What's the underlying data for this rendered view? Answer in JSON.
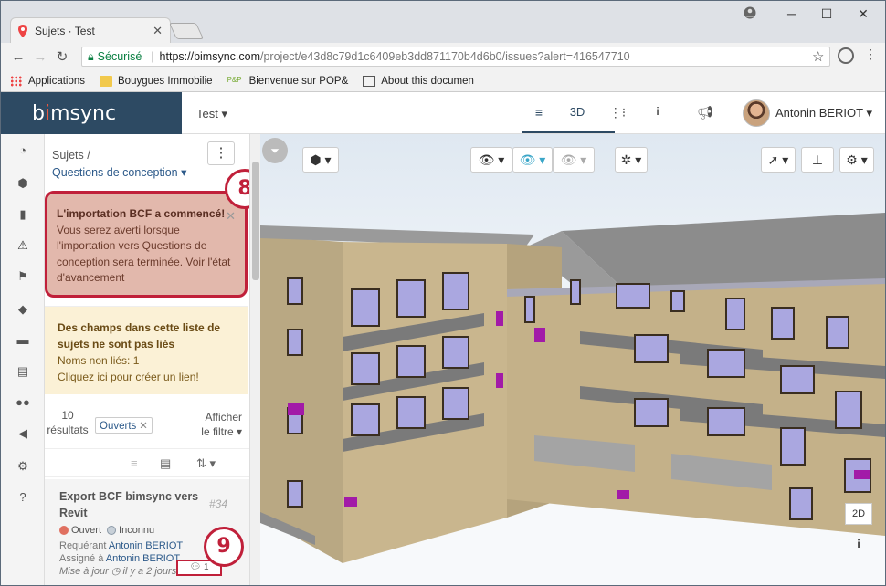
{
  "browser": {
    "tab_title": "Sujets · Test",
    "secure_label": "Sécurisé",
    "url_main": "https://bimsync.com",
    "url_rest": "/project/e43d8c79d1c6409eb3dd871170b4d6b0/issues?alert=416547710",
    "bookmarks": [
      "Applications",
      "Bouygues Immobilie",
      "Bienvenue sur POP&",
      "About this documen"
    ]
  },
  "app": {
    "logo_pre": "b",
    "logo_dot": "i",
    "logo_post": "msync",
    "project": "Test ▾",
    "nav": {
      "view3d": "3D"
    },
    "user": "Antonin BERIOT ▾"
  },
  "panel": {
    "crumb": "Sujets /",
    "list_name": "Questions de conception ▾",
    "kebab": "⋮",
    "bcf_bold": "L'importation BCF a commencé!",
    "bcf_text": " Vous serez averti lorsque l'importation vers Questions de conception sera terminée. Voir l'état d'avancement",
    "warn_bold": "Des champs dans cette liste de sujets ne sont pas liés",
    "warn_line1": "Noms non liés: 1",
    "warn_line2": "Cliquez ici pour créer un lien!",
    "count_num": "10",
    "count_label": "résultats",
    "filter_chip": "Ouverts",
    "show_filter_1": "Afficher",
    "show_filter_2": "le filtre ▾",
    "issue": {
      "title": "Export BCF bimsync vers Revit",
      "number": "#34",
      "status_open": "Ouvert",
      "status_unknown": "Inconnu",
      "requester_label": "Requérant ",
      "requester": "Antonin BERIOT",
      "assigned_label": "Assigné à ",
      "assigned": "Antonin BERIOT",
      "updated": "Mise à jour ◷ il y a 2 jours.",
      "comments": "1"
    }
  },
  "callouts": {
    "c8": "8",
    "c9": "9"
  },
  "viewer": {
    "btn_2d": "2D",
    "btn_info": "i"
  },
  "colors": {
    "brand": "#2d4a63",
    "accent": "#c0203a",
    "open": "#e07060",
    "unknown": "#c8d0d8"
  }
}
